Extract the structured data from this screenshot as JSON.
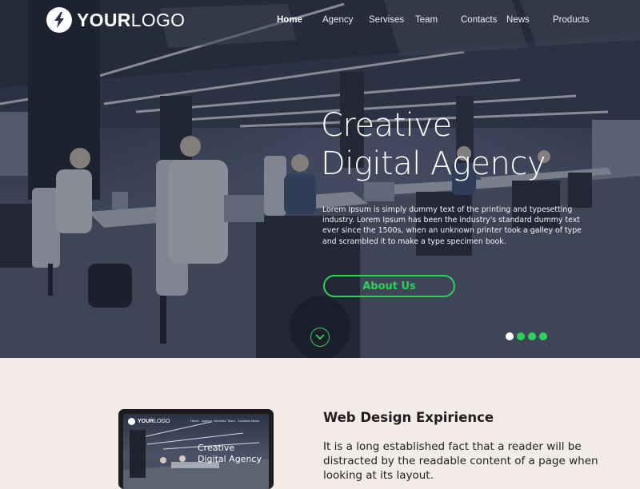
{
  "header": {
    "logo_text_bold": "YOUR",
    "logo_text_regular": "LOGO",
    "logo_icon": "lightning-bolt-icon"
  },
  "nav": {
    "items": [
      {
        "label": "Home",
        "active": true
      },
      {
        "label": "Agency",
        "active": false
      },
      {
        "label": "Servises",
        "active": false
      },
      {
        "label": "Team",
        "active": false
      },
      {
        "label": "Contacts",
        "active": false
      },
      {
        "label": "News",
        "active": false
      },
      {
        "label": "Products",
        "active": false
      }
    ]
  },
  "hero": {
    "title_line1": "Creative",
    "title_line2": "Digital Agency",
    "text": "Lorem Ipsum is simply dummy text of the printing and typesetting industry. Lorem Ipsum has been the industry's standard dummy text ever since the 1500s, when an unknown printer took a galley of type and scrambled it to make a type specimen book.",
    "button_label": "About Us",
    "scroll_icon": "chevron-down-icon",
    "slider": {
      "count": 4,
      "active_index": 0
    }
  },
  "feature": {
    "title": "Web Design Expirience",
    "text": "It is a long established fact that a reader will be distracted by the readable content of a page when looking at its layout.",
    "preview": {
      "logo_text_bold": "YOUR",
      "logo_text_regular": "LOGO",
      "title_line1": "Creative",
      "title_line2": "Digital Agency"
    }
  },
  "colors": {
    "accent": "#2fd05a",
    "section_bg": "#f2ebe8"
  }
}
